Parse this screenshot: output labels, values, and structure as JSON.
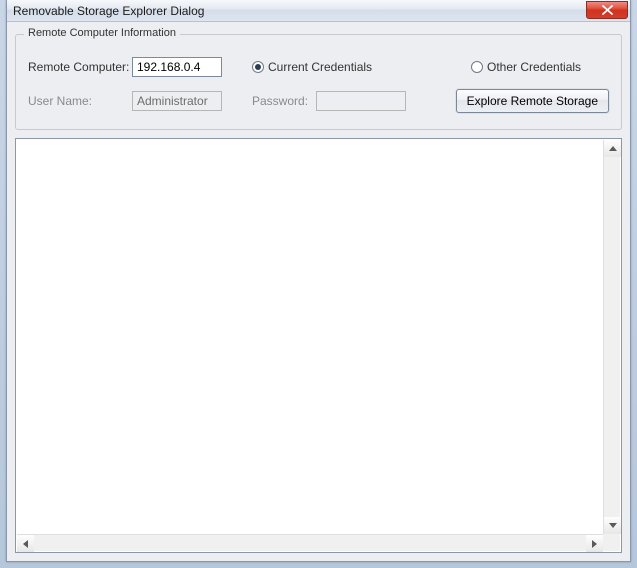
{
  "window": {
    "title": "Removable Storage Explorer Dialog"
  },
  "group": {
    "legend": "Remote Computer Information",
    "remote_computer_label": "Remote Computer:",
    "remote_computer_value": "192.168.0.4",
    "user_name_label": "User Name:",
    "user_name_value": "Administrator",
    "password_label": "Password:",
    "password_value": "",
    "current_credentials_label": "Current Credentials",
    "other_credentials_label": "Other Credentials",
    "credentials_selected": "current",
    "explore_button_label": "Explore Remote Storage"
  }
}
